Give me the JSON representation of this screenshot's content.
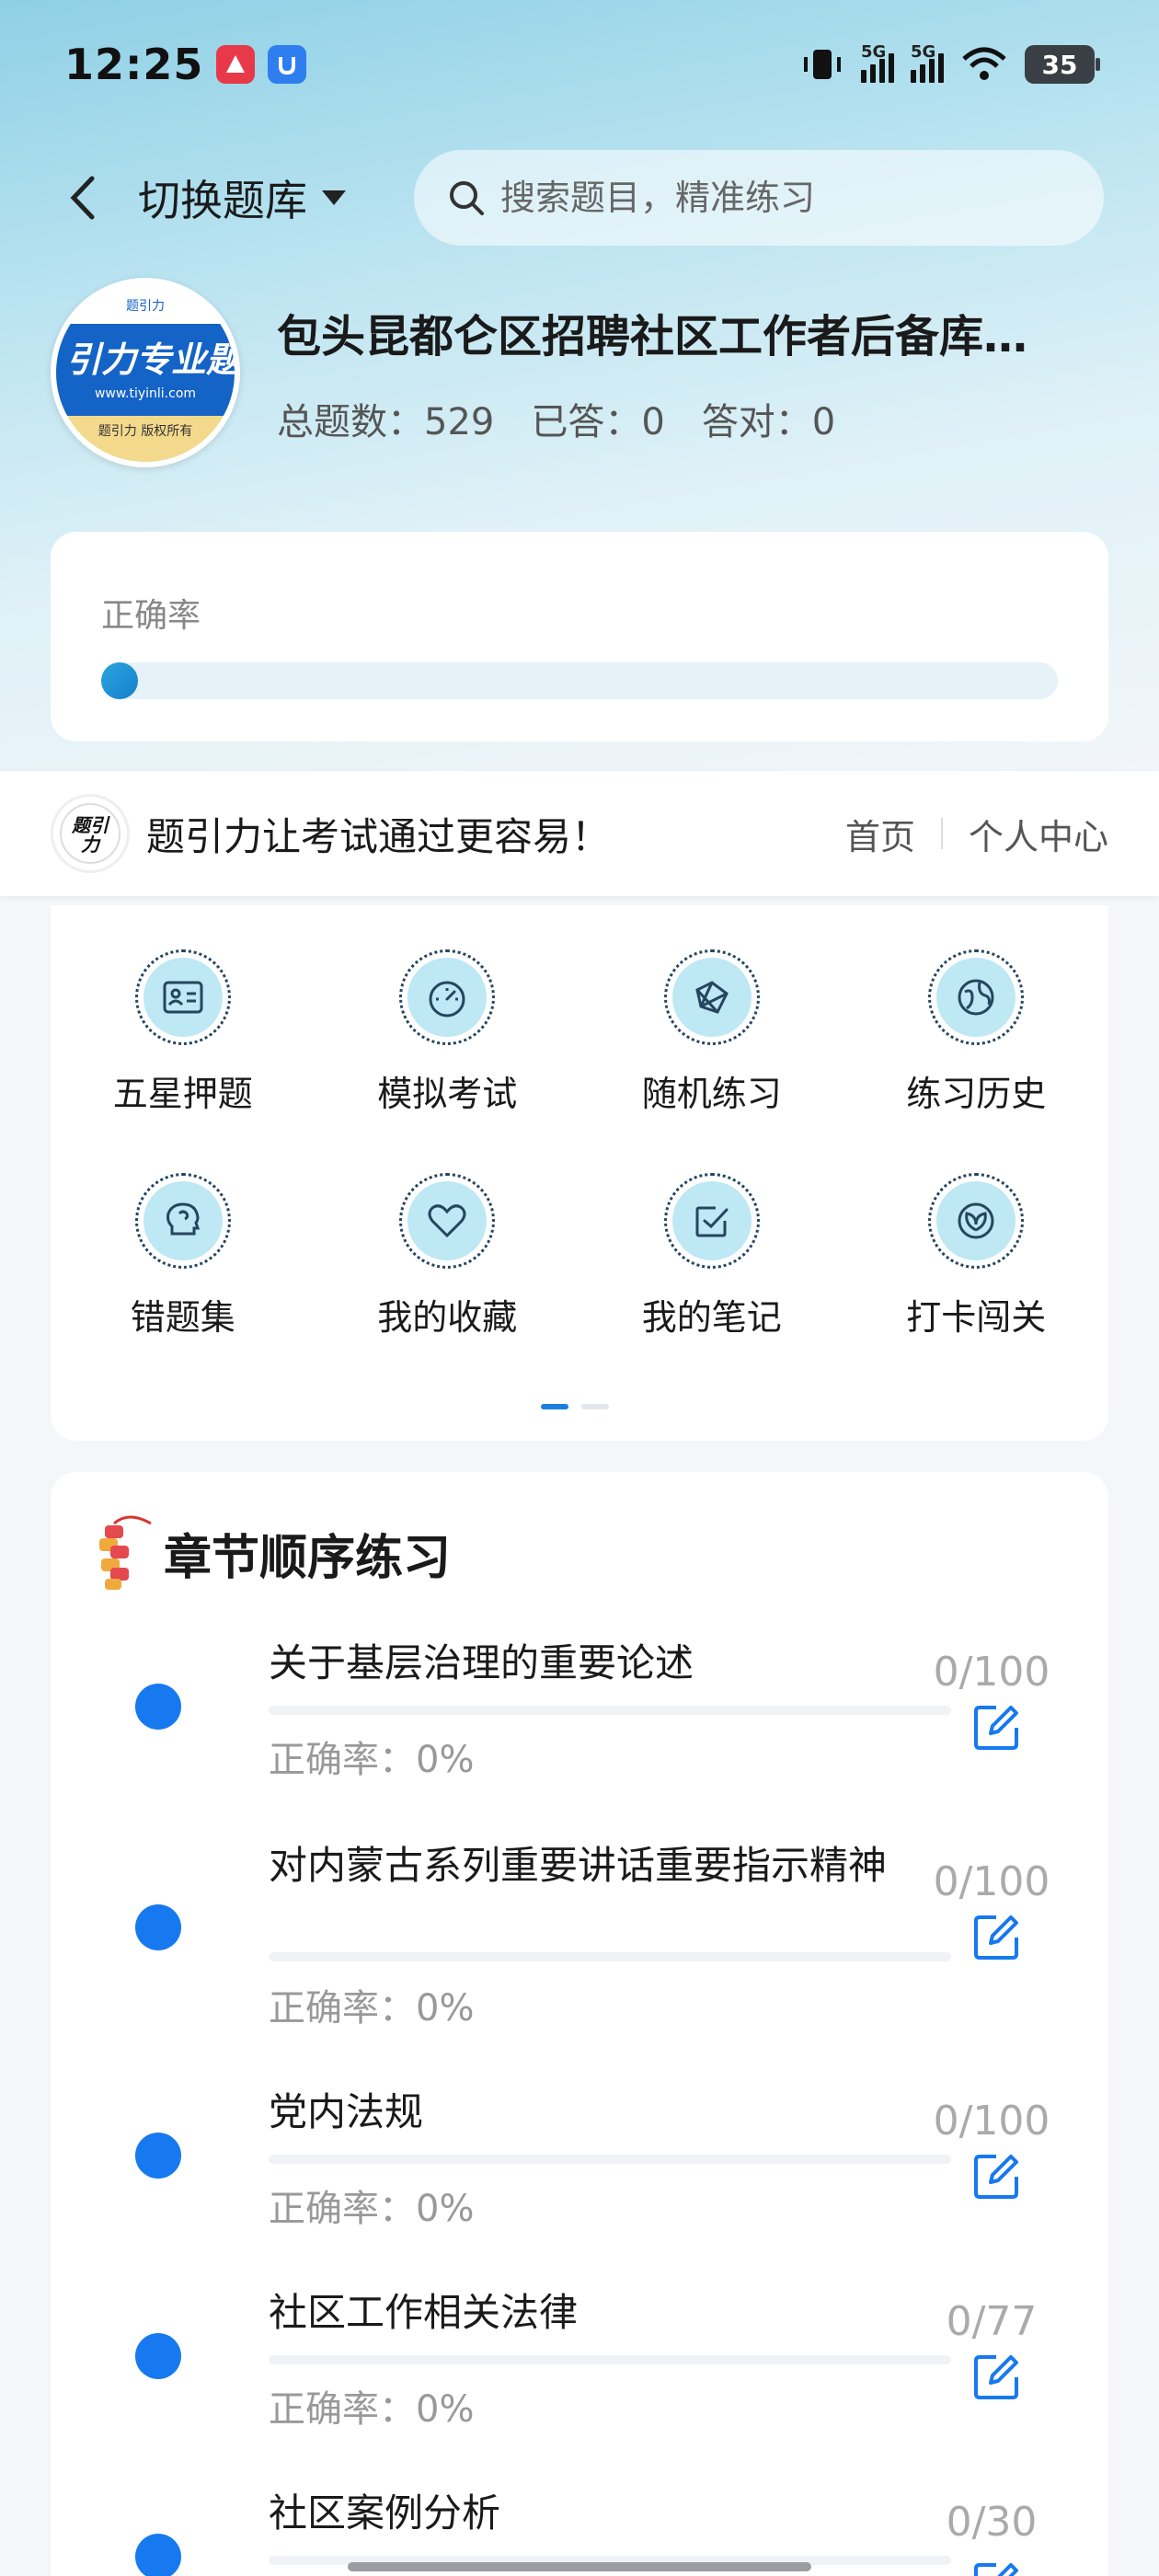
{
  "status_bar": {
    "time": "12:25",
    "network_1": "5G",
    "network_2": "5G",
    "battery": "35"
  },
  "header": {
    "switch_label": "切换题库",
    "search_placeholder": "搜索题目，精准练习"
  },
  "bank": {
    "title": "包头昆都仑区招聘社区工作者后备库…",
    "avatar_brand": "引力专业题",
    "avatar_url": "www.tiyinli.com",
    "avatar_copyright": "题引力 版权所有",
    "avatar_top": "题引力",
    "stats": {
      "total": "总题数：529",
      "answered": "已答：0",
      "correct": "答对：0"
    }
  },
  "accuracy": {
    "label": "正确率",
    "value": 0
  },
  "banner": {
    "logo_text": "题引力",
    "slogan": "题引力让考试通过更容易！",
    "link_home": "首页",
    "link_profile": "个人中心"
  },
  "grid": {
    "items": [
      {
        "label": "五星押题",
        "icon": "id-card-icon"
      },
      {
        "label": "模拟考试",
        "icon": "speedometer-icon"
      },
      {
        "label": "随机练习",
        "icon": "shuffle-icon"
      },
      {
        "label": "练习历史",
        "icon": "globe-icon"
      },
      {
        "label": "错题集",
        "icon": "brain-icon"
      },
      {
        "label": "我的收藏",
        "icon": "heart-icon"
      },
      {
        "label": "我的笔记",
        "icon": "checkbox-icon"
      },
      {
        "label": "打卡闯关",
        "icon": "leaf-icon"
      }
    ],
    "page": 1,
    "pages": 2
  },
  "chapters": {
    "title": "章节顺序练习",
    "items": [
      {
        "name": "关于基层治理的重要论述",
        "accuracy": "正确率：0%",
        "count": "0/100"
      },
      {
        "name": "对内蒙古系列重要讲话重要指示精神",
        "accuracy": "正确率：0%",
        "count": "0/100"
      },
      {
        "name": "党内法规",
        "accuracy": "正确率：0%",
        "count": "0/100"
      },
      {
        "name": "社区工作相关法律",
        "accuracy": "正确率：0%",
        "count": "0/77"
      },
      {
        "name": "社区案例分析",
        "accuracy": "",
        "count": "0/30"
      }
    ]
  },
  "colors": {
    "accent": "#1779ef",
    "icon_bg": "#bde8f4",
    "muted_text": "#999999"
  }
}
